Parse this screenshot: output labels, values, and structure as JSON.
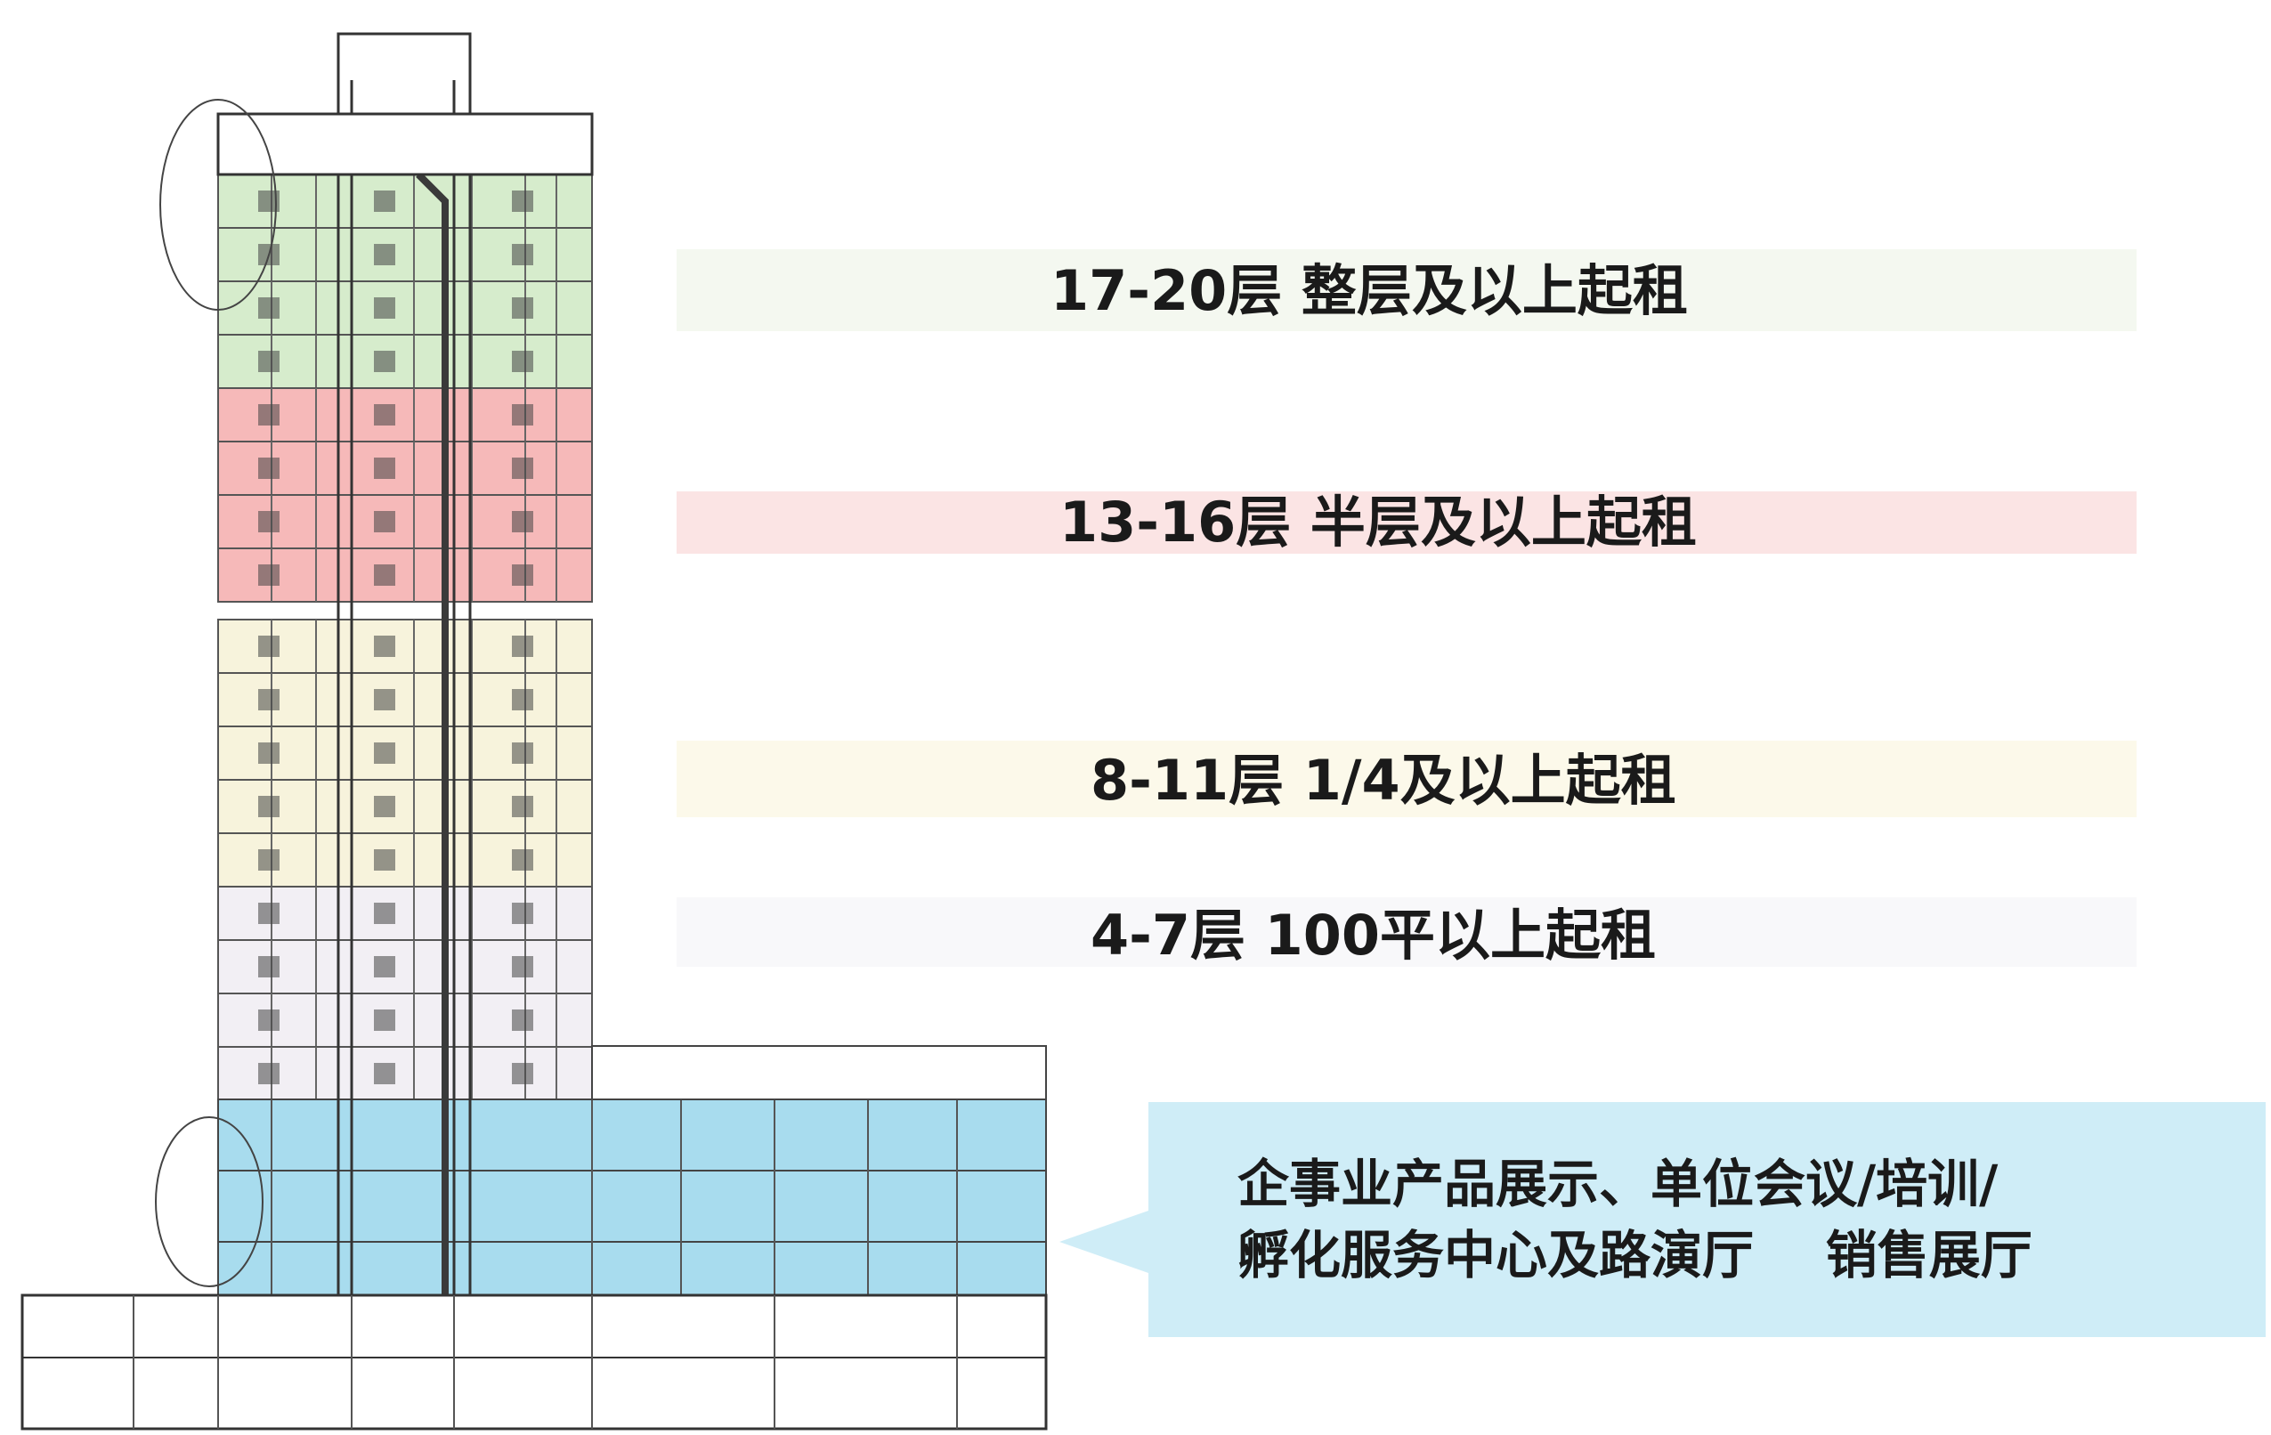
{
  "zones": [
    {
      "id": "top",
      "floors": [
        17,
        20
      ],
      "label": "17-20层 整层及以上起租",
      "fill": "#d6eccc",
      "band": "#f4f8f0"
    },
    {
      "id": "upper",
      "floors": [
        13,
        16
      ],
      "label": "13-16层 半层及以上起租",
      "fill": "#f6b9b9",
      "band": "#fbe4e4"
    },
    {
      "id": "middle",
      "floors": [
        8,
        11
      ],
      "label": "8-11层 1/4及以上起租",
      "fill": "#f7f3dc",
      "band": "#fcf9ea"
    },
    {
      "id": "lower",
      "floors": [
        4,
        7
      ],
      "label": "4-7层  100平以上起租",
      "fill": "#f2eff4",
      "band": "#f8f8fa"
    }
  ],
  "podium": {
    "fill": "#a8dcee",
    "callout_lines": [
      "企事业产品展示、单位会议/培训/",
      "孵化服务中心及路演厅    销售展厅"
    ],
    "callout_fill": "#cfedf7"
  }
}
